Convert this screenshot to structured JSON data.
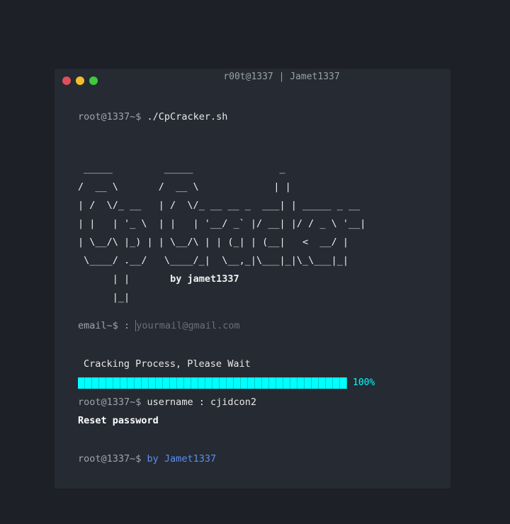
{
  "window": {
    "title": "r00t@1337 | Jamet1337",
    "controls": {
      "close_color": "#e0505a",
      "minimize_color": "#f5bd2a",
      "maximize_color": "#3ec93e"
    }
  },
  "terminal": {
    "prompt": "root@1337~$",
    "command": "./CpCracker.sh",
    "banner_art": " _____         _____               _\n/  __ \\       /  __ \\             | |\n| /  \\/_ __   | /  \\/_ __ __ _  ___| | _____ _ __\n| |   | '_ \\  | |   | '__/ _` |/ __| |/ / _ \\ '__|\n| \\__/\\ |_) | | \\__/\\ | | (_| | (__|   <  __/ |\n \\____/ .__/   \\____/_|  \\__,_|\\___|_|\\_\\___|_|\n      | |",
    "banner_last": "      |_|",
    "banner_byline": "by jamet1337",
    "email_prompt": "email~$ :",
    "email_placeholder": "yourmail@gmail.com",
    "status": "Cracking Process, Please Wait",
    "progress_percent": 100,
    "progress_label": "100%",
    "progress_color": "#00ffff",
    "username_line": "username : cjidcon2",
    "reset_label": "Reset password",
    "footer_text": "by Jamet1337"
  }
}
